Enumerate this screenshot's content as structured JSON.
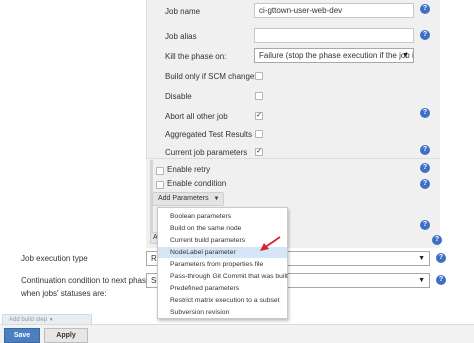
{
  "form": {
    "job_name_label": "Job name",
    "job_name_value": "ci-gttown-user-web-dev",
    "job_alias_label": "Job alias",
    "job_alias_value": "",
    "kill_phase_label": "Kill the phase on:",
    "kill_phase_value": "Failure (stop the phase execution if the job is",
    "build_only_scm_label": "Build only if SCM changes",
    "build_only_scm_checked": false,
    "disable_label": "Disable",
    "disable_checked": false,
    "abort_all_label": "Abort all other job",
    "abort_all_checked": true,
    "aggregated_tests_label": "Aggregated Test Results",
    "aggregated_tests_checked": false,
    "current_params_label": "Current job parameters",
    "current_params_checked": true,
    "enable_retry_label": "Enable retry",
    "enable_retry_checked": false,
    "enable_condition_label": "Enable condition",
    "enable_condition_checked": false,
    "add_parameters_label": "Add Parameters",
    "job_execution_type_label": "Job execution type",
    "job_execution_type_value": "Ru",
    "continuation_label_line1": "Continuation condition to next phase",
    "continuation_label_line2": "when jobs' statuses are:",
    "continuation_value": "Su",
    "partial_button_letter": "A"
  },
  "menu": {
    "items": [
      {
        "label": "Boolean parameters",
        "highlighted": false
      },
      {
        "label": "Build on the same node",
        "highlighted": false
      },
      {
        "label": "Current build parameters",
        "highlighted": false
      },
      {
        "label": "NodeLabel parameter",
        "highlighted": true
      },
      {
        "label": "Parameters from properties file",
        "highlighted": false
      },
      {
        "label": "Pass-through Git Commit that was built",
        "highlighted": false
      },
      {
        "label": "Predefined parameters",
        "highlighted": false
      },
      {
        "label": "Restrict matrix execution to a subset",
        "highlighted": false
      },
      {
        "label": "Subversion revision",
        "highlighted": false
      }
    ]
  },
  "footer": {
    "add_build_step_label": "Add build step",
    "save_label": "Save",
    "apply_label": "Apply"
  },
  "icons": {
    "help": "help-icon",
    "checkmark": "checkmark-icon",
    "dropdown": "chevron-down-icon",
    "annotation": "red-arrow-icon"
  },
  "colors": {
    "accent_blue": "#3f6ec7",
    "save_button": "#4b7fbf",
    "menu_highlight": "#d7e6f7",
    "annotation_arrow": "#d9232e"
  }
}
